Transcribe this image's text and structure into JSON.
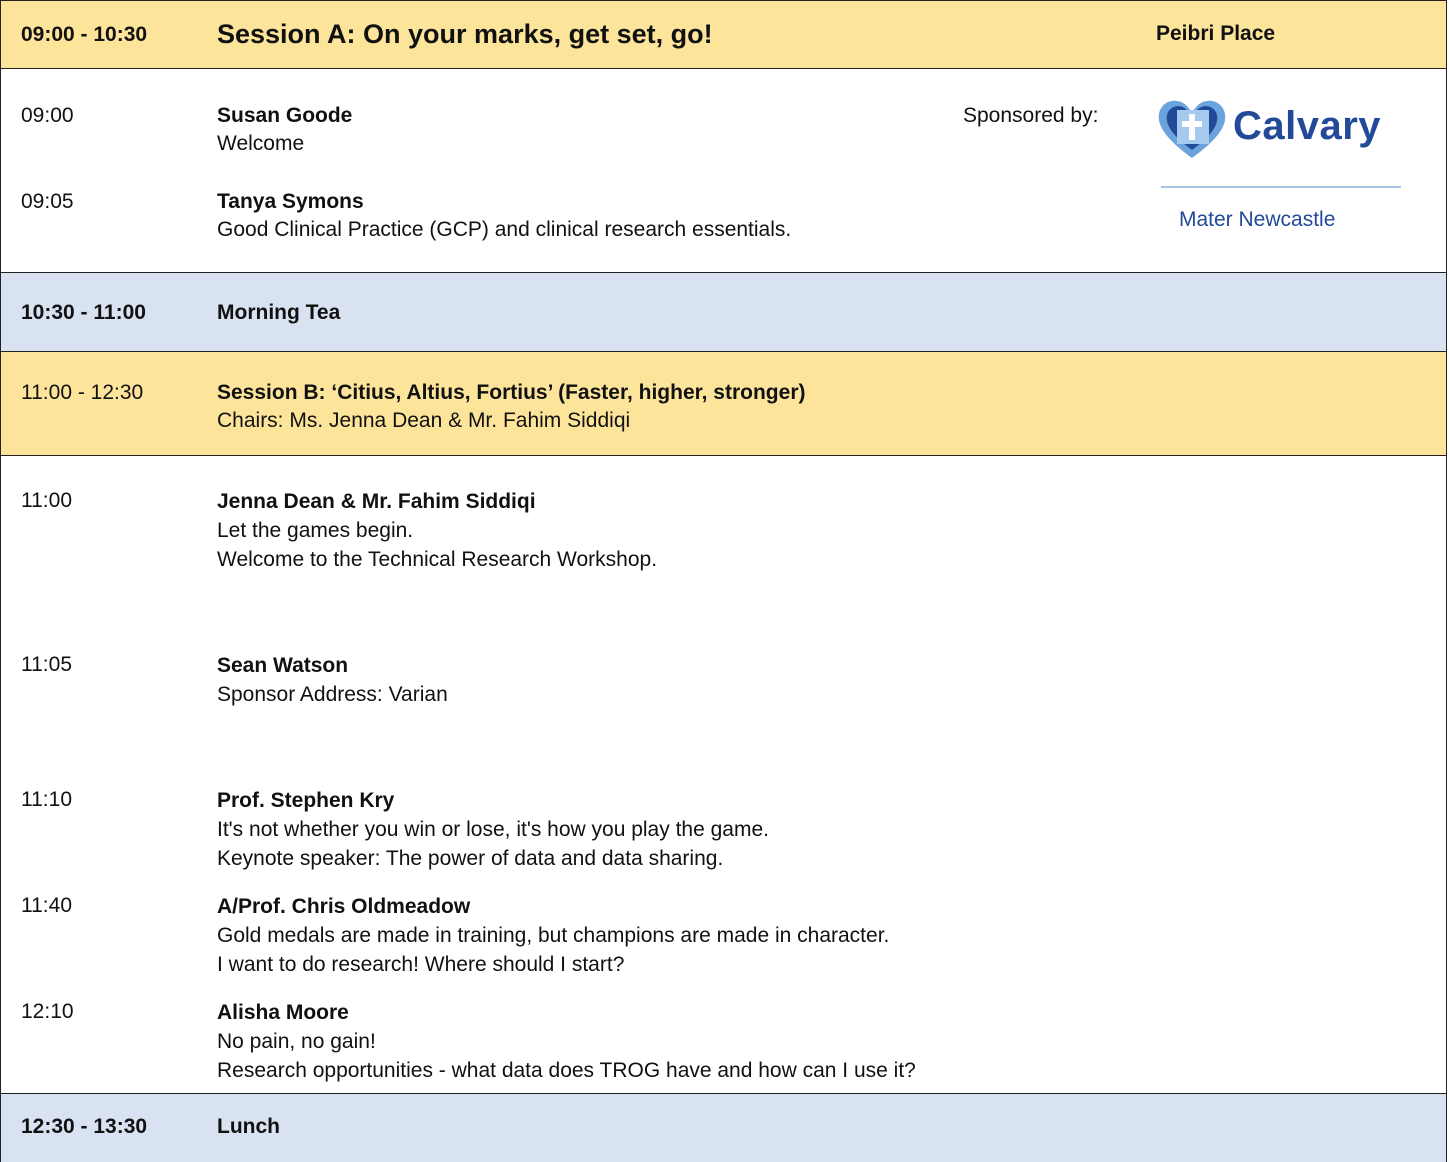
{
  "session_a": {
    "time": "09:00 - 10:30",
    "title": "Session A: On your marks, get set, go!",
    "venue": "Peibri Place",
    "sponsor_label": "Sponsored by:",
    "sponsor_logo": {
      "name": "Calvary",
      "subtitle": "Mater Newcastle",
      "brand_color": "#234a99"
    },
    "talks": [
      {
        "time": "09:00",
        "speaker": "Susan Goode",
        "lines": [
          "Welcome"
        ]
      },
      {
        "time": "09:05",
        "speaker": "Tanya Symons",
        "lines": [
          "Good Clinical Practice (GCP) and clinical research essentials."
        ]
      }
    ]
  },
  "morning_tea": {
    "time": "10:30 - 11:00",
    "title": "Morning Tea"
  },
  "session_b": {
    "time": "11:00 - 12:30",
    "title": "Session B: ‘Citius, Altius, Fortius’ (Faster, higher, stronger)",
    "chairs": "Chairs: Ms. Jenna Dean & Mr. Fahim Siddiqi",
    "talks": [
      {
        "time": "11:00",
        "speaker": "Jenna Dean & Mr. Fahim Siddiqi",
        "lines": [
          "Let the games begin.",
          "Welcome to the Technical Research Workshop."
        ]
      },
      {
        "time": "11:05",
        "speaker": "Sean Watson",
        "lines": [
          "Sponsor Address: Varian"
        ]
      },
      {
        "time": "11:10",
        "speaker": "Prof. Stephen Kry",
        "lines": [
          "It's not whether you win or lose, it's how you play the game.",
          "Keynote speaker: The power of data and data sharing."
        ]
      },
      {
        "time": "11:40",
        "speaker": "A/Prof. Chris Oldmeadow",
        "lines": [
          "Gold medals are made in training, but champions are made in character.",
          "I want to do research! Where should I start?"
        ]
      },
      {
        "time": "12:10",
        "speaker": "Alisha Moore",
        "lines": [
          "No pain, no gain!",
          "Research opportunities - what data does TROG have and how can I use it?"
        ]
      }
    ]
  },
  "lunch": {
    "time": "12:30 - 13:30",
    "title": "Lunch"
  },
  "colors": {
    "session_header": "#fde49b",
    "break_header": "#d9e2f1"
  }
}
